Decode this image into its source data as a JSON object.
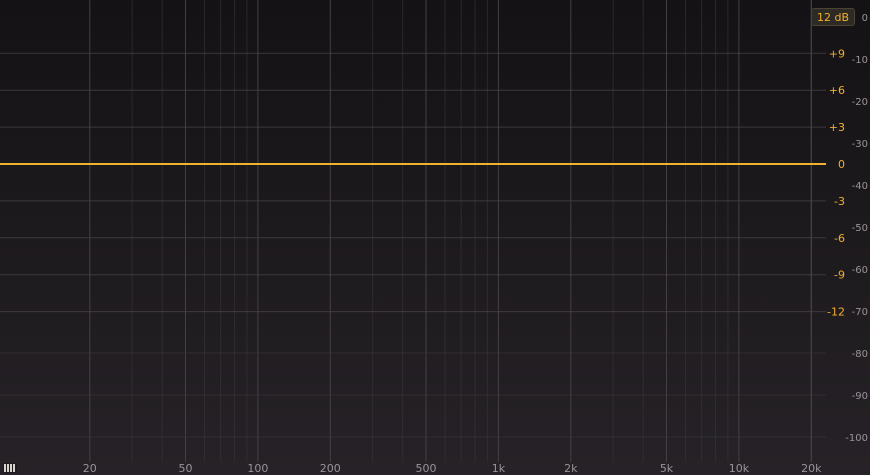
{
  "analyzer": {
    "range_button_label": "12 dB",
    "colors": {
      "background_top": "#141214",
      "background_bottom": "#262227",
      "grid": "#3a3538",
      "grid_major": "#4a4448",
      "eq_curve": "#f0b030",
      "gain_labels": "#f0b030",
      "db_labels": "#9a9498",
      "freq_labels": "#9a9498"
    },
    "frequency_labels": [
      "20",
      "50",
      "100",
      "200",
      "500",
      "1k",
      "2k",
      "5k",
      "10k",
      "20k"
    ],
    "frequency_values": [
      20,
      50,
      100,
      200,
      500,
      1000,
      2000,
      5000,
      10000,
      20000
    ],
    "gain_labels": [
      "+9",
      "+6",
      "+3",
      "0",
      "-3",
      "-6",
      "-9",
      "-12"
    ],
    "gain_values": [
      9,
      6,
      3,
      0,
      -3,
      -6,
      -9,
      -12
    ],
    "db_labels": [
      "0",
      "-10",
      "-20",
      "-30",
      "-40",
      "-50",
      "-60",
      "-70",
      "-80",
      "-90",
      "-100"
    ],
    "db_values": [
      0,
      -10,
      -20,
      -30,
      -40,
      -50,
      -60,
      -70,
      -80,
      -90,
      -100
    ],
    "eq_curve_gain": 0,
    "piano_icon": "piano-keys-icon"
  }
}
